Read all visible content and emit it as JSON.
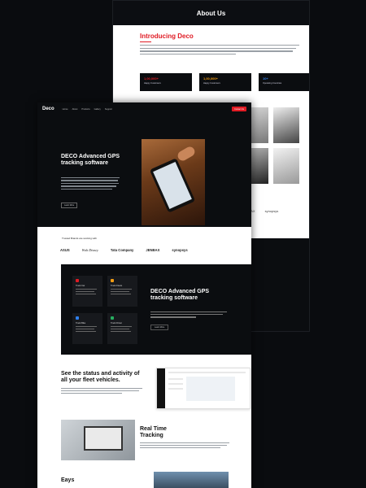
{
  "back_page": {
    "hero_title": "About Us",
    "intro_title": "Introducing Deco",
    "stats": [
      {
        "value": "1,00,000+",
        "label": "Happy Customers",
        "color": "#e01b24"
      },
      {
        "value": "1,00,000+",
        "label": "Happy Customers",
        "color": "#f39c12"
      },
      {
        "value": "10+",
        "label": "Operating Countries",
        "color": "#2f80ed"
      }
    ],
    "logos": [
      "JENBAX",
      "synopsys"
    ]
  },
  "front_page": {
    "logo": "Deco",
    "nav": [
      "Home",
      "About",
      "Products",
      "Gallery",
      "Support"
    ],
    "nav_cta": "Contact Us",
    "hero_title": "DECO Advanced GPS tracking software",
    "hero_button": "Learn More",
    "trusted_label": "Trusted Brands are working with",
    "trusted_logos": [
      "ASUS",
      "Walt Disney",
      "Tata Company",
      "JENBAX",
      "synopsys"
    ],
    "features": [
      {
        "title": "Track Car",
        "color": "#e01b24"
      },
      {
        "title": "Track Fleets",
        "color": "#f39c12"
      },
      {
        "title": "Track Bike",
        "color": "#2f80ed"
      },
      {
        "title": "Track Driver",
        "color": "#27ae60"
      }
    ],
    "features_title": "DECO Advanced GPS tracking software",
    "features_button": "Learn More",
    "status_title": "See the status and activity of all your fleet vehicles.",
    "realtime_title": "Real Time Tracking",
    "easy_title": "Eays"
  }
}
